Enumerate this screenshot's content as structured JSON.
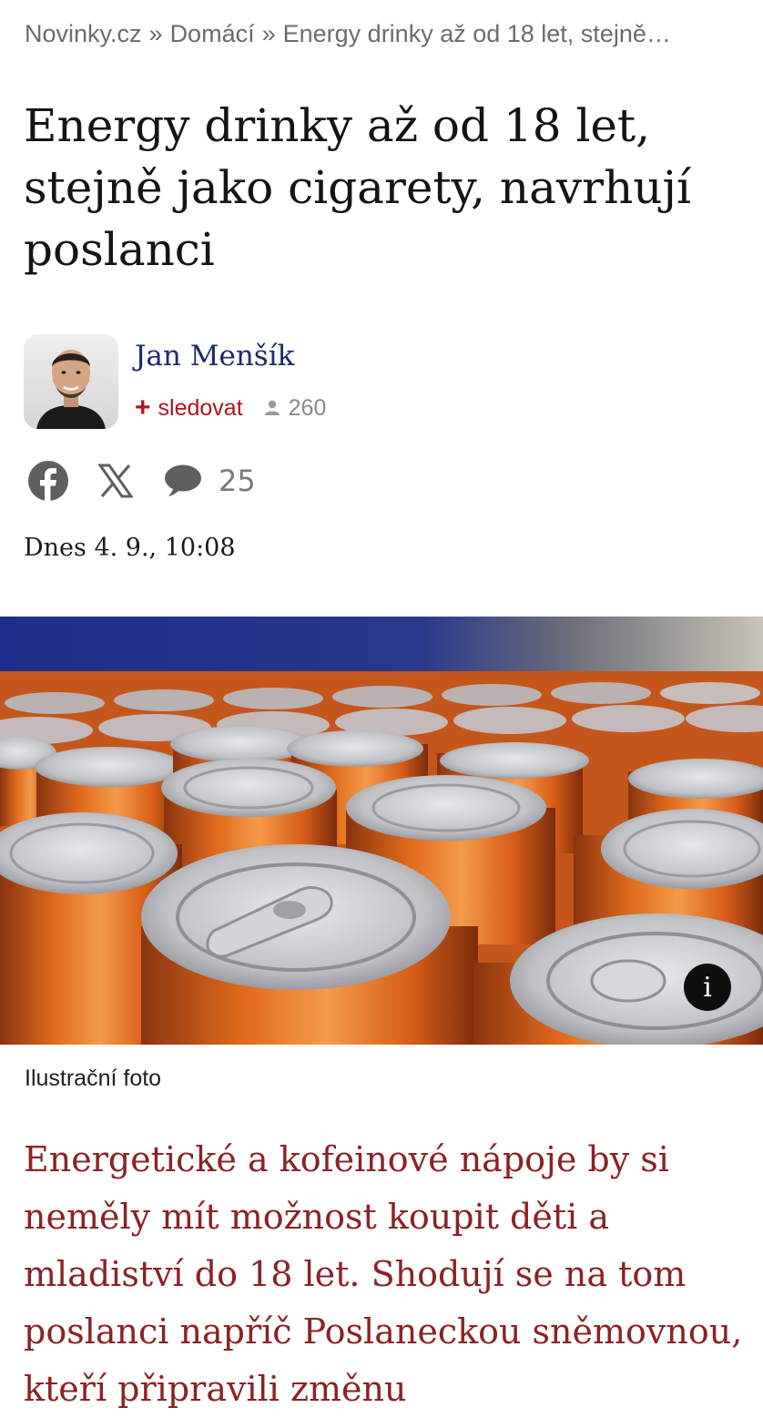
{
  "breadcrumb": {
    "site": "Novinky.cz",
    "separator": "»",
    "section": "Domácí",
    "current": "Energy drinky až od 18 let, stejně…"
  },
  "article": {
    "headline": "Energy drinky až od 18 let, stejně jako cigarety, navrhují poslanci",
    "author": {
      "name": "Jan Menšík",
      "follow_symbol": "+",
      "follow_label": "sledovat",
      "followers_count": "260"
    },
    "share": {
      "facebook_icon": "facebook-icon",
      "x_icon": "x-icon",
      "comments_icon": "comment-bubble-icon",
      "comments_count": "25"
    },
    "date": "Dnes 4. 9., 10:08",
    "photo": {
      "info_label": "i",
      "caption": "Ilustrační foto"
    },
    "perex": "Energetické a kofeinové nápoje by si neměly mít možnost koupit děti a mladiství do 18 let. Shodují se na tom poslanci napříč Poslaneckou sněmovnou, kteří připravili změnu"
  },
  "colors": {
    "accent_red": "#b0141c",
    "perex_red": "#8a2226",
    "author_blue": "#1c2a6b",
    "muted_gray": "#6b6b6b"
  }
}
